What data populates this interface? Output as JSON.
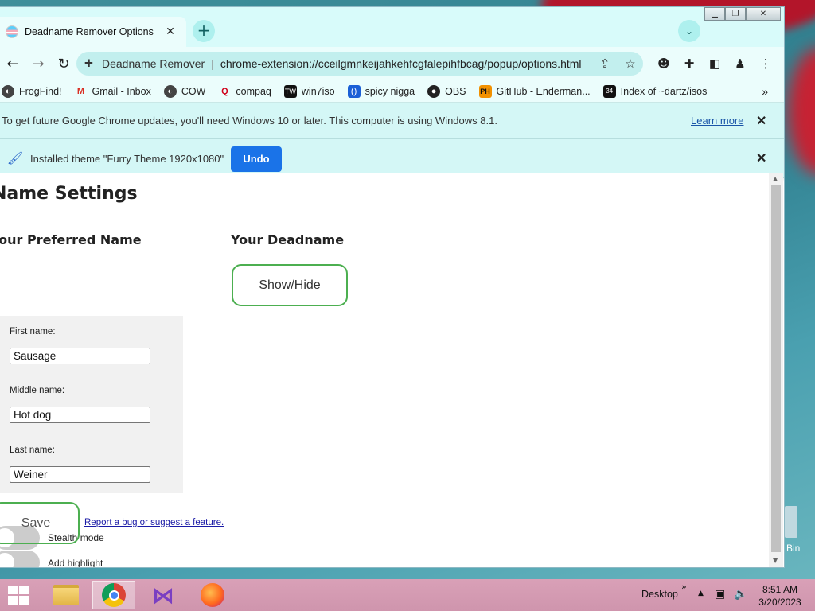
{
  "browser": {
    "tab_title": "Deadname Remover Options",
    "tab_close": "✕",
    "new_tab": "+",
    "window_minimize": "▁",
    "window_restore": "❐",
    "window_close": "✕",
    "omnibox": {
      "extension_name": "Deadname Remover",
      "separator": "|",
      "url": "chrome-extension://cceilgmnkeijahkehfcgfalepihfbcag/popup/options.html"
    },
    "bookmarks": [
      {
        "label": "FrogFind!",
        "icon": "globe-icon"
      },
      {
        "label": "Gmail - Inbox",
        "icon": "gmail-icon"
      },
      {
        "label": "COW",
        "icon": "globe-icon"
      },
      {
        "label": "compaq",
        "icon": "q-icon"
      },
      {
        "label": "win7iso",
        "icon": "tw-icon"
      },
      {
        "label": "spicy nigga",
        "icon": "bracket-icon"
      },
      {
        "label": "OBS",
        "icon": "github-icon"
      },
      {
        "label": "GitHub - Enderman...",
        "icon": "ph-icon"
      },
      {
        "label": "Index of ~dartz/isos",
        "icon": "grid-icon"
      }
    ],
    "bookmarks_more": "»",
    "update_bar": {
      "message": "To get future Google Chrome updates, you'll need Windows 10 or later. This computer is using Windows 8.1.",
      "link": "Learn more",
      "close": "✕"
    },
    "theme_bar": {
      "message": "Installed theme \"Furry Theme 1920x1080\"",
      "undo": "Undo",
      "close": "✕"
    }
  },
  "page": {
    "title": "Name Settings",
    "preferred_heading": "Your Preferred Name",
    "deadname_heading": "Your Deadname",
    "show_hide": "Show/Hide",
    "fields": [
      {
        "label": "First name:",
        "value": "Sausage"
      },
      {
        "label": "Middle name:",
        "value": "Hot dog"
      },
      {
        "label": "Last name:",
        "value": "Weiner"
      }
    ],
    "save": "Save",
    "bug_link": "Report a bug or suggest a feature.",
    "toggles": [
      {
        "label": "Stealth mode",
        "on": false
      },
      {
        "label": "Add highlight",
        "on": false
      }
    ]
  },
  "desktop": {
    "bin_label": "Bin"
  },
  "taskbar": {
    "desktop_label": "Desktop",
    "chevron": "»",
    "time": "8:51 AM",
    "date": "3/20/2023"
  },
  "colors": {
    "accent_blue": "#1a73e8",
    "green_border": "#4caf50",
    "browser_tint": "#d4f7f6"
  }
}
